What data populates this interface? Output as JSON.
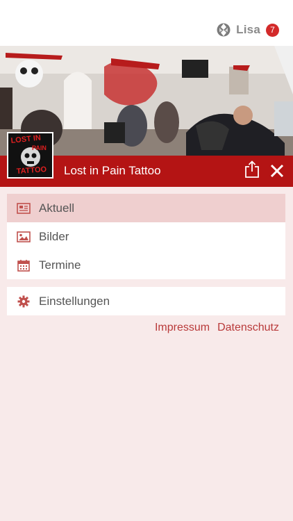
{
  "header": {
    "user_name": "Lisa",
    "notification_count": "7"
  },
  "banner": {
    "title": "Lost in Pain Tattoo",
    "logo_text": [
      "LOST IN",
      "PAIN",
      "TATTOO"
    ]
  },
  "menu": {
    "items": [
      {
        "label": "Aktuell",
        "icon": "newspaper-icon",
        "active": true
      },
      {
        "label": "Bilder",
        "icon": "image-icon",
        "active": false
      },
      {
        "label": "Termine",
        "icon": "calendar-icon",
        "active": false
      }
    ],
    "settings": {
      "label": "Einstellungen",
      "icon": "gear-icon"
    }
  },
  "footer_links": {
    "impressum": "Impressum",
    "datenschutz": "Datenschutz"
  },
  "colors": {
    "accent": "#b41414",
    "badge": "#d32a2a",
    "page_bg": "#f8eaea",
    "active_item": "#efcfcf",
    "link": "#b93a3a"
  }
}
